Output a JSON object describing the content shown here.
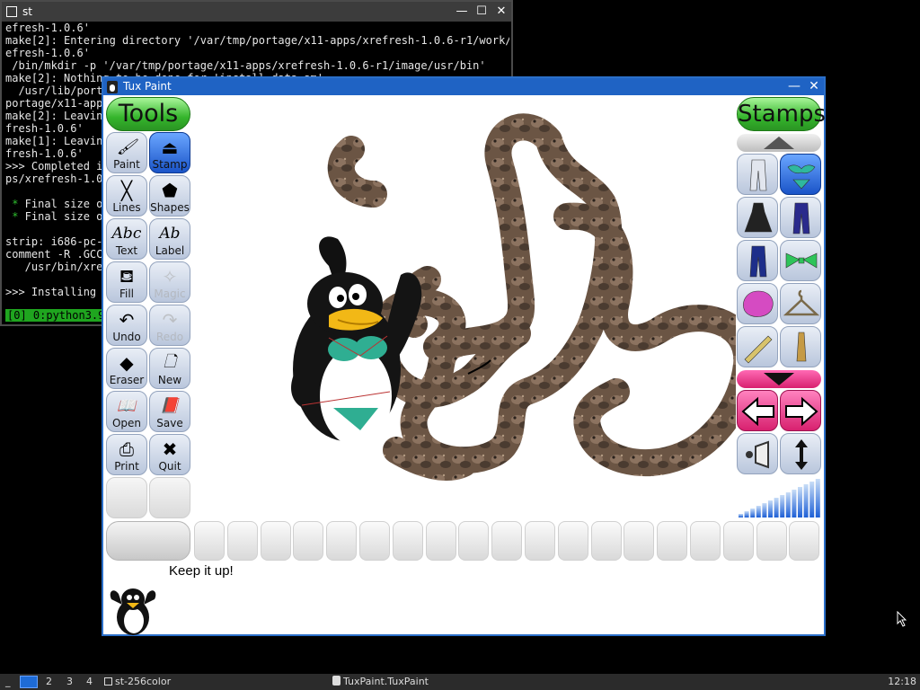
{
  "terminal": {
    "title": "st",
    "lines": [
      "efresh-1.0.6'",
      "make[2]: Entering directory '/var/tmp/portage/x11-apps/xrefresh-1.0.6-r1/work/xr",
      "efresh-1.0.6'",
      " /bin/mkdir -p '/var/tmp/portage/x11-apps/xrefresh-1.0.6-r1/image/usr/bin'",
      "make[2]: Nothing to be done for 'install-data-am'.",
      "  /usr/lib/port",
      "portage/x11-app",
      "make[2]: Leavin",
      "fresh-1.0.6'",
      "make[1]: Leavin",
      "fresh-1.0.6'",
      ">>> Completed i",
      "ps/xrefresh-1.0",
      "",
      " * Final size o",
      " * Final size o",
      "",
      "strip: i686-pc-",
      "comment -R .GCC",
      "   /usr/bin/xre",
      "",
      ">>> Installing"
    ],
    "tmux_status": "[0] 0:python3.9"
  },
  "tuxpaint": {
    "title": "Tux Paint",
    "tools_header": "Tools",
    "stamps_header": "Stamps",
    "tools": [
      {
        "label": "Paint",
        "icon": "paintbrush-icon",
        "glyph": "🖌",
        "state": "normal"
      },
      {
        "label": "Stamp",
        "icon": "stamp-icon",
        "glyph": "⏏",
        "state": "selected"
      },
      {
        "label": "Lines",
        "icon": "lines-icon",
        "glyph": "╳",
        "state": "normal"
      },
      {
        "label": "Shapes",
        "icon": "shapes-icon",
        "glyph": "⬟",
        "state": "normal"
      },
      {
        "label": "Text",
        "icon": "text-icon",
        "glyph": "Abc",
        "state": "normal"
      },
      {
        "label": "Label",
        "icon": "label-icon",
        "glyph": "Ab",
        "state": "normal"
      },
      {
        "label": "Fill",
        "icon": "fill-bucket-icon",
        "glyph": "⛾",
        "state": "normal"
      },
      {
        "label": "Magic",
        "icon": "magic-wand-icon",
        "glyph": "✧",
        "state": "disabled"
      },
      {
        "label": "Undo",
        "icon": "undo-icon",
        "glyph": "↶",
        "state": "normal"
      },
      {
        "label": "Redo",
        "icon": "redo-icon",
        "glyph": "↷",
        "state": "disabled"
      },
      {
        "label": "Eraser",
        "icon": "eraser-icon",
        "glyph": "◆",
        "state": "normal"
      },
      {
        "label": "New",
        "icon": "new-page-icon",
        "glyph": "🗋",
        "state": "normal"
      },
      {
        "label": "Open",
        "icon": "open-book-icon",
        "glyph": "📖",
        "state": "normal"
      },
      {
        "label": "Save",
        "icon": "save-book-icon",
        "glyph": "📕",
        "state": "normal"
      },
      {
        "label": "Print",
        "icon": "printer-icon",
        "glyph": "⎙",
        "state": "normal"
      },
      {
        "label": "Quit",
        "icon": "quit-icon",
        "glyph": "✖",
        "state": "normal"
      }
    ],
    "stamps": [
      {
        "name": "stamp-pants-white",
        "color": "#e2e6ee",
        "selected": false
      },
      {
        "name": "stamp-bikini-green",
        "color": "#2fb89e",
        "selected": true
      },
      {
        "name": "stamp-dress-black",
        "color": "#222222",
        "selected": false
      },
      {
        "name": "stamp-jeans-purple",
        "color": "#2a2a8c",
        "selected": false
      },
      {
        "name": "stamp-jeans-blue",
        "color": "#1d2e8a",
        "selected": false
      },
      {
        "name": "stamp-bowtie-green",
        "color": "#2ec45a",
        "selected": false
      },
      {
        "name": "stamp-button-pink",
        "color": "#d54bc2",
        "selected": false
      },
      {
        "name": "stamp-hanger",
        "color": "#7a6a4a",
        "selected": false
      },
      {
        "name": "stamp-clothespin-yellow",
        "color": "#d8c36b",
        "selected": false
      },
      {
        "name": "stamp-clothespin-wood",
        "color": "#c59a45",
        "selected": false
      }
    ],
    "status_message": "Keep it up!",
    "palette_count": 19
  },
  "taskbar": {
    "workspaces": [
      "2",
      "3",
      "4"
    ],
    "tasks": [
      "st-256color",
      "TuxPaint.TuxPaint"
    ],
    "clock": "12:18"
  },
  "colors": {
    "tools_header": "#35b52c",
    "selected_button": "#1a54c8",
    "stamp_nav": "#d8216f",
    "window_titlebar": "#1f63c4",
    "taskbar": "#2b2b2b"
  }
}
